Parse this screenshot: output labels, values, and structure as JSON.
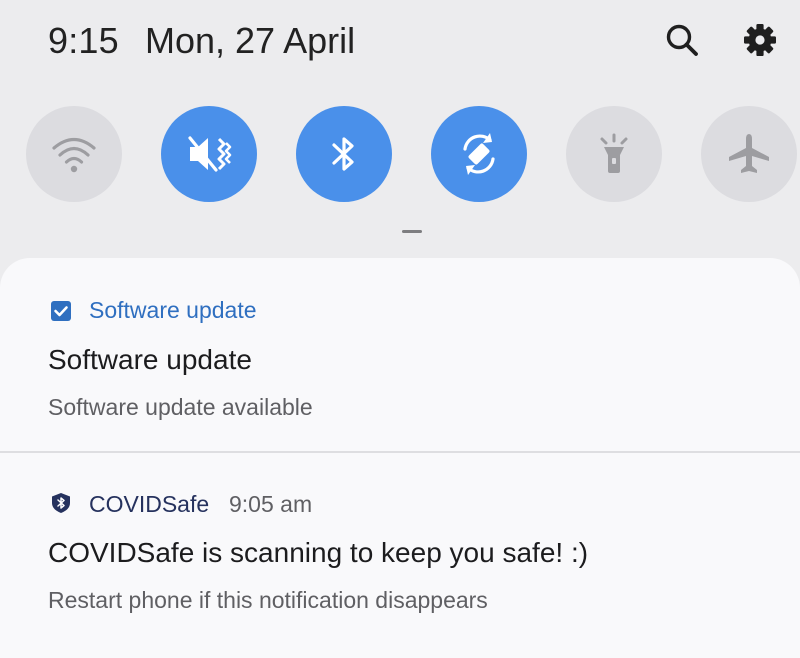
{
  "status": {
    "time": "9:15",
    "date": "Mon, 27 April"
  },
  "header_icons": [
    {
      "icon": "search-icon"
    },
    {
      "icon": "settings-gear-icon"
    }
  ],
  "quick_tiles": [
    {
      "icon": "wifi-icon",
      "state": "off"
    },
    {
      "icon": "vibrate-icon",
      "state": "on"
    },
    {
      "icon": "bluetooth-icon",
      "state": "on"
    },
    {
      "icon": "auto-rotate-icon",
      "state": "on"
    },
    {
      "icon": "flashlight-icon",
      "state": "off"
    },
    {
      "icon": "airplane-mode-icon",
      "state": "off"
    }
  ],
  "notifications": [
    {
      "app": "Software update",
      "app_icon": "checkbox-icon",
      "time": "",
      "title": "Software update",
      "body": "Software update available"
    },
    {
      "app": "COVIDSafe",
      "app_icon": "shield-bluetooth-icon",
      "time": "9:05 am",
      "title": "COVIDSafe is scanning to keep you safe! :)",
      "body": "Restart phone if this notification disappears"
    }
  ],
  "colors": {
    "background": "#ececee",
    "tile_on": "#4a90ea",
    "tile_off": "#dcdce0",
    "accent_text": "#2f6fc0",
    "covidsafe_icon": "#26325e"
  }
}
